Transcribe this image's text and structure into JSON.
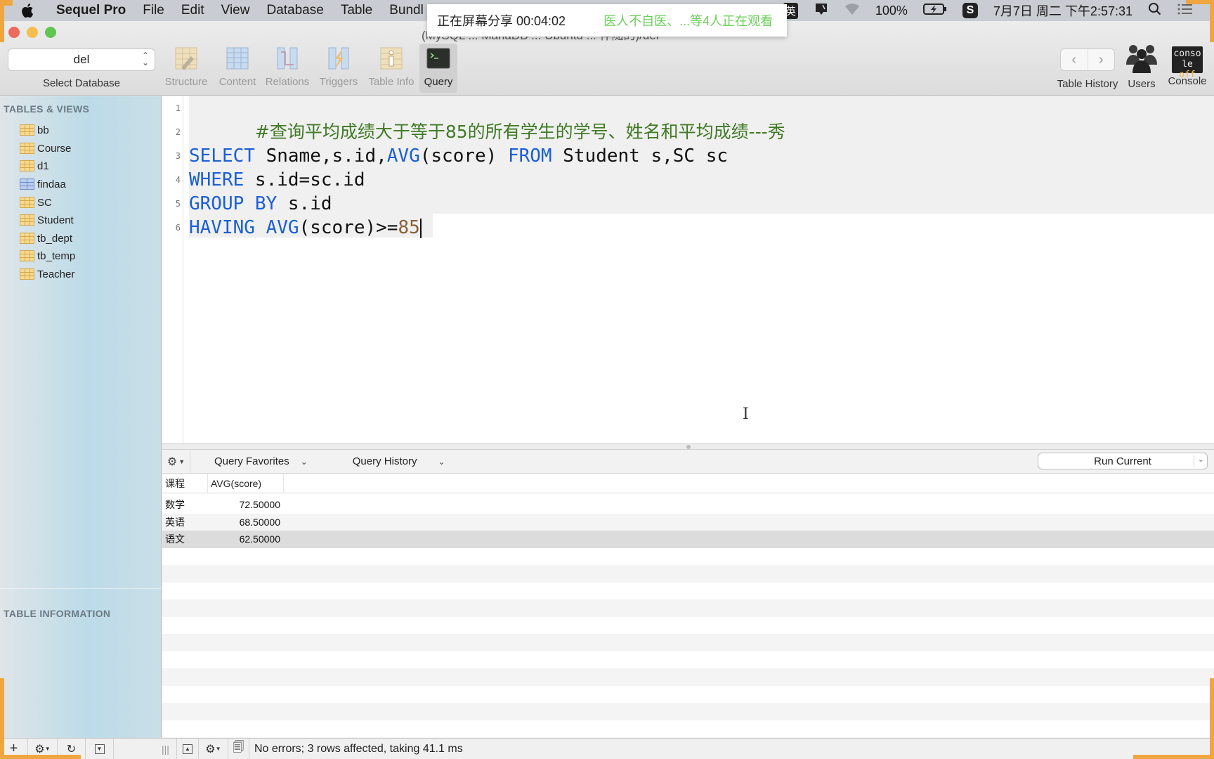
{
  "menubar": {
    "app_name": "Sequel Pro",
    "items": [
      "File",
      "Edit",
      "View",
      "Database",
      "Table",
      "Bundl"
    ],
    "ime": "英",
    "battery": "100%",
    "datetime": "7月7日 周二 下午2:57:31"
  },
  "share_banner": {
    "timer": "正在屏幕分享 00:04:02",
    "viewers": "医人不自医、...等4人正在观看"
  },
  "window": {
    "title_fragment": "(MySQL ... MariaDB ... Ubuntu ... 伴随的)/del"
  },
  "toolbar": {
    "database_value": "del",
    "database_label": "Select Database",
    "tools": [
      {
        "label": "Structure",
        "icon": "structure-icon"
      },
      {
        "label": "Content",
        "icon": "content-icon"
      },
      {
        "label": "Relations",
        "icon": "relations-icon"
      },
      {
        "label": "Triggers",
        "icon": "triggers-icon"
      },
      {
        "label": "Table Info",
        "icon": "table-info-icon"
      },
      {
        "label": "Query",
        "icon": "query-icon",
        "active": true
      }
    ],
    "table_history_label": "Table History",
    "users_label": "Users",
    "console_label": "Console",
    "console_badge_top": "conso",
    "console_badge_bottom_a": "le ",
    "console_badge_bottom_b": "off"
  },
  "sidebar": {
    "tables_heading": "TABLES & VIEWS",
    "tables": [
      {
        "name": "bb",
        "type": "table"
      },
      {
        "name": "Course",
        "type": "table"
      },
      {
        "name": "d1",
        "type": "table"
      },
      {
        "name": "findaa",
        "type": "view"
      },
      {
        "name": "SC",
        "type": "table"
      },
      {
        "name": "Student",
        "type": "table"
      },
      {
        "name": "tb_dept",
        "type": "table"
      },
      {
        "name": "tb_temp",
        "type": "table"
      },
      {
        "name": "Teacher",
        "type": "table"
      }
    ],
    "info_heading": "TABLE INFORMATION"
  },
  "editor": {
    "line_numbers": [
      "1",
      "2",
      "3",
      "4",
      "5",
      "6"
    ],
    "line1_comment": "#查询平均成绩大于等于85的所有学生的学号、姓名和平均成绩---秀",
    "line3": {
      "kw1": "SELECT",
      "t1": " Sname,s.id,",
      "kw2": "AVG",
      "t2": "(score) ",
      "kw3": "FROM",
      "t3": " Student s,SC sc"
    },
    "line4": {
      "kw1": "WHERE",
      "t1": " s.id=sc.id"
    },
    "line5": {
      "kw1": "GROUP BY",
      "t1": " s.id"
    },
    "line6": {
      "kw1": "HAVING",
      "t1": " ",
      "kw2": "AVG",
      "t2": "(score)>=",
      "num": "85"
    }
  },
  "query_bar": {
    "favorites_label": "Query Favorites",
    "history_label": "Query History",
    "run_label": "Run Current"
  },
  "results": {
    "columns": [
      "课程",
      "AVG(score)"
    ],
    "rows": [
      [
        "数学",
        "72.50000"
      ],
      [
        "英语",
        "68.50000"
      ],
      [
        "语文",
        "62.50000"
      ]
    ]
  },
  "status": {
    "message": "No errors; 3 rows affected, taking 41.1 ms"
  }
}
